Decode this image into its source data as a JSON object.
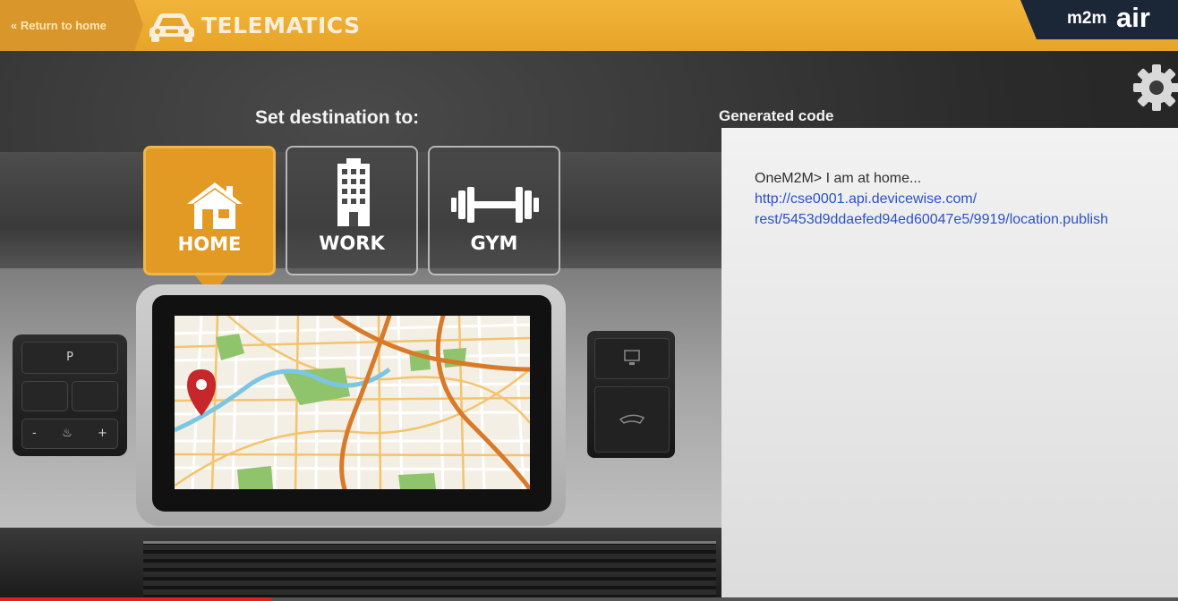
{
  "header": {
    "back_label": "« Return to home",
    "title": "TELEMATICS",
    "title_icon": "car-icon",
    "brand_prefix": "m2m",
    "brand_suffix": "air"
  },
  "destination": {
    "heading": "Set destination to:",
    "options": [
      {
        "label": "HOME",
        "icon": "house-icon",
        "selected": true
      },
      {
        "label": "WORK",
        "icon": "building-icon",
        "selected": false
      },
      {
        "label": "GYM",
        "icon": "dumbbell-icon",
        "selected": false
      }
    ]
  },
  "dashboard": {
    "gear_key": "P",
    "volume_minus": "-",
    "volume_plus": "+"
  },
  "code": {
    "heading": "Generated code",
    "message": "OneM2M> I am at home...",
    "url_line1": "http://cse0001.api.devicewise.com/",
    "url_line2": "rest/5453d9ddaefed94ed60047e5/9919/location.publish"
  },
  "settings_icon": "gear-icon",
  "colors": {
    "header_yellow": "#e7a428",
    "accent_orange": "#e39a24",
    "brand_navy": "#1b2636",
    "link_blue": "#2a52c9"
  },
  "video_progress": 0.23
}
